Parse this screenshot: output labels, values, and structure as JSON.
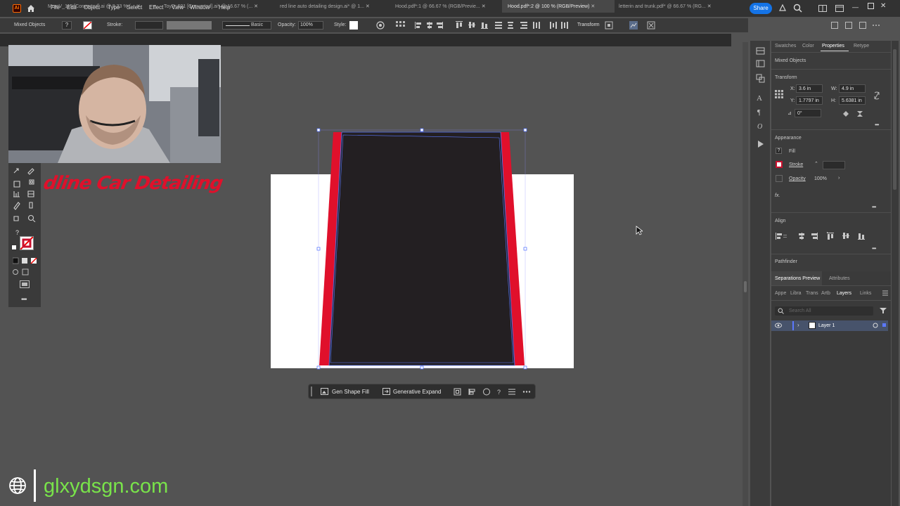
{
  "app": {
    "logo_text": "Ai"
  },
  "menu": [
    "File",
    "Edit",
    "Object",
    "Type",
    "Select",
    "Effect",
    "View",
    "Window",
    "Help"
  ],
  "share_label": "Share",
  "control_bar": {
    "selection_label": "Mixed Objects",
    "stroke_label": "Stroke:",
    "brush_label": "Basic",
    "opacity_label": "Opacity:",
    "opacity_value": "100%",
    "style_label": "Style:",
    "transform_label": "Transform"
  },
  "tabs": [
    {
      "label": "MercV_115 [Converted].ai @ 8.33 % (...",
      "active": false
    },
    {
      "label": "ToyP_601 [Converted].ai* @ 16.67 % (...",
      "active": false
    },
    {
      "label": "red line auto detailing design.ai* @ 1...",
      "active": false
    },
    {
      "label": "Hood.pdf*:1 @ 66.67 % (RGB/Previe...",
      "active": false
    },
    {
      "label": "Hood.pdf*:2 @ 100 % (RGB/Preview)",
      "active": true
    },
    {
      "label": "letterin and trunk.pdf* @ 66.67 % (RG...",
      "active": false
    }
  ],
  "context_bar": {
    "gen_shape_fill": "Gen Shape Fill",
    "generative_expand": "Generative Expand"
  },
  "panel": {
    "tabs": [
      "Swatches",
      "Color",
      "Properties",
      "Retype"
    ],
    "active_tab": "Properties",
    "selection": "Mixed Objects",
    "transform_title": "Transform",
    "x_label": "X:",
    "x_value": "3.6 in",
    "y_label": "Y:",
    "y_value": "1.7797 in",
    "w_label": "W:",
    "w_value": "4.9 in",
    "h_label": "H:",
    "h_value": "5.6381 in",
    "angle_value": "0°",
    "appearance_title": "Appearance",
    "fill_label": "Fill",
    "stroke_label": "Stroke",
    "opacity_label": "Opacity",
    "opacity_value": "100%",
    "fx_label": "fx.",
    "align_title": "Align",
    "pathfinder_title": "Pathfinder"
  },
  "layers_panel": {
    "top_tabs": [
      "Separations Preview",
      "Attributes"
    ],
    "tabs": [
      "Appe",
      "Libra",
      "Trans",
      "Artb",
      "Layers",
      "Links"
    ],
    "active_tab": "Layers",
    "search_placeholder": "Search All",
    "layer_name": "Layer 1"
  },
  "overlay": {
    "brand_text": "dline Car Detailing",
    "footer_url": "glxydsgn.com"
  },
  "colors": {
    "accent_red": "#e0102b",
    "shape_dark": "#231f22",
    "selection_blue": "#4a6cff",
    "share_blue": "#1473e6",
    "footer_green": "#79e34a"
  }
}
